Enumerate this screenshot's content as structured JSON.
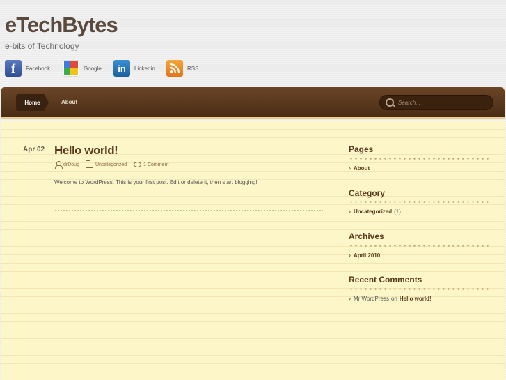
{
  "site": {
    "title": "eTechBytes",
    "description": "e-bits of Technology"
  },
  "social": [
    {
      "label": "Facebook",
      "icon": "facebook-icon",
      "glyph": "f",
      "color": "#3b5998"
    },
    {
      "label": "Google",
      "icon": "google-icon",
      "color": "#3b7de0"
    },
    {
      "label": "Linkedin",
      "icon": "linkedin-icon",
      "glyph": "in",
      "color": "#1a62a0"
    },
    {
      "label": "RSS",
      "icon": "rss-icon",
      "color": "#f39c3a"
    }
  ],
  "nav": {
    "items": [
      {
        "label": "Home",
        "active": true
      },
      {
        "label": "About",
        "active": false
      }
    ],
    "search_placeholder": "Search..."
  },
  "post": {
    "date": "Apr 02",
    "title": "Hello world!",
    "author": "drDoug",
    "category": "Uncategorized",
    "comments": "1 Comment",
    "body": "Welcome to WordPress. This is your first post. Edit or delete it, then start blogging!"
  },
  "sidebar": {
    "pages": {
      "title": "Pages",
      "items": [
        "About"
      ]
    },
    "category": {
      "title": "Category",
      "items": [
        {
          "name": "Uncategorized",
          "count": "(1)"
        }
      ]
    },
    "archives": {
      "title": "Archives",
      "items": [
        "April 2010"
      ]
    },
    "recent_comments": {
      "title": "Recent Comments",
      "items": [
        {
          "author": "Mr WordPress",
          "on": "on",
          "post": "Hello world!"
        }
      ]
    }
  },
  "colors": {
    "nav_bg": "#5a3a1e",
    "content_bg": "#fcf6c8",
    "heading": "#5a3a1e"
  }
}
